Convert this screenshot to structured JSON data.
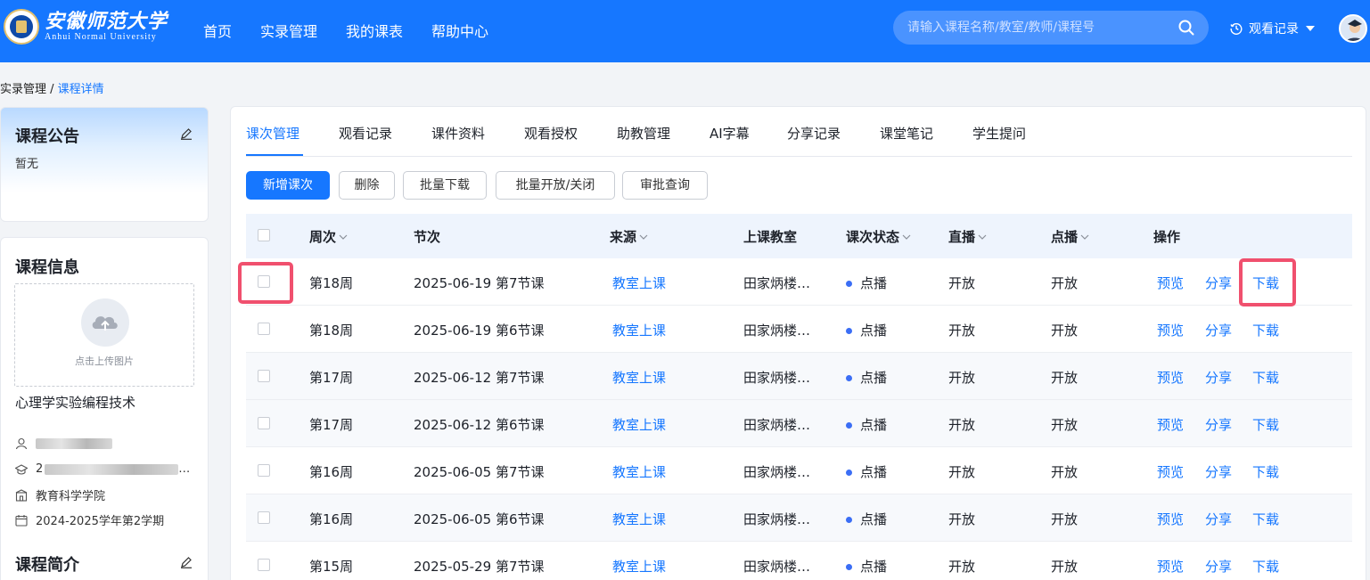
{
  "header": {
    "logo_cn": "安徽师范大学",
    "logo_en": "Anhui Normal University",
    "nav": [
      "首页",
      "实录管理",
      "我的课表",
      "帮助中心"
    ],
    "search_placeholder": "请输入课程名称/教室/教师/课程号",
    "history_label": "观看记录"
  },
  "breadcrumb": {
    "parent": "实录管理",
    "separator": " / ",
    "current": "课程详情"
  },
  "notice": {
    "title": "课程公告",
    "content": "暂无"
  },
  "info": {
    "title": "课程信息",
    "upload_text": "点击上传图片",
    "course_name": "心理学实验编程技术",
    "class_prefix": "2",
    "class_suffix": "…",
    "department": "教育科学学院",
    "semester": "2024-2025学年第2学期"
  },
  "intro": {
    "title": "课程简介"
  },
  "tabs": [
    "课次管理",
    "观看记录",
    "课件资料",
    "观看授权",
    "助教管理",
    "AI字幕",
    "分享记录",
    "课堂笔记",
    "学生提问"
  ],
  "buttons": {
    "add": "新增课次",
    "delete": "删除",
    "batch_download": "批量下载",
    "batch_toggle": "批量开放/关闭",
    "approval": "审批查询"
  },
  "columns": {
    "week": "周次",
    "period": "节次",
    "source": "来源",
    "room": "上课教室",
    "status": "课次状态",
    "live": "直播",
    "vod": "点播",
    "ops": "操作"
  },
  "actions": {
    "preview": "预览",
    "share": "分享",
    "download": "下载"
  },
  "rows": [
    {
      "week": "第18周",
      "period": "2025-06-19 第7节课",
      "source": "教室上课",
      "room": "田家炳楼…",
      "status": "点播",
      "live": "开放",
      "vod": "开放"
    },
    {
      "week": "第18周",
      "period": "2025-06-19 第6节课",
      "source": "教室上课",
      "room": "田家炳楼…",
      "status": "点播",
      "live": "开放",
      "vod": "开放"
    },
    {
      "week": "第17周",
      "period": "2025-06-12 第7节课",
      "source": "教室上课",
      "room": "田家炳楼…",
      "status": "点播",
      "live": "开放",
      "vod": "开放"
    },
    {
      "week": "第17周",
      "period": "2025-06-12 第6节课",
      "source": "教室上课",
      "room": "田家炳楼…",
      "status": "点播",
      "live": "开放",
      "vod": "开放"
    },
    {
      "week": "第16周",
      "period": "2025-06-05 第7节课",
      "source": "教室上课",
      "room": "田家炳楼…",
      "status": "点播",
      "live": "开放",
      "vod": "开放"
    },
    {
      "week": "第16周",
      "period": "2025-06-05 第6节课",
      "source": "教室上课",
      "room": "田家炳楼…",
      "status": "点播",
      "live": "开放",
      "vod": "开放"
    },
    {
      "week": "第15周",
      "period": "2025-05-29 第7节课",
      "source": "教室上课",
      "room": "田家炳楼…",
      "status": "点播",
      "live": "开放",
      "vod": "开放"
    }
  ],
  "colors": {
    "primary": "#1677ff",
    "highlight": "#f0506e",
    "status_dot": "#3b6ef5"
  }
}
